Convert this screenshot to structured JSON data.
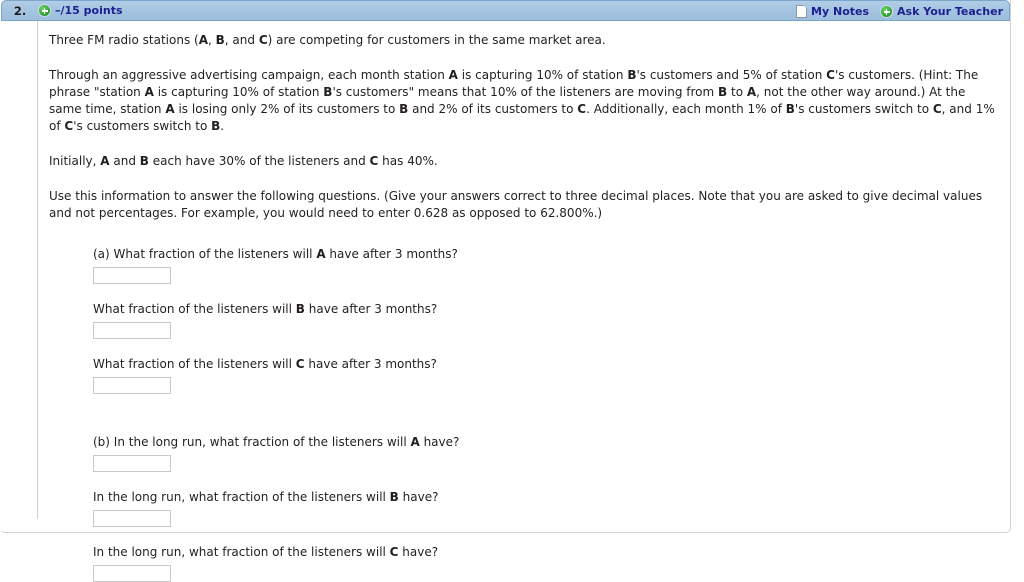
{
  "header": {
    "question_number": "2.",
    "points_label": "–/15 points",
    "plus_icon": "plus-circle-icon",
    "my_notes": {
      "label": "My Notes",
      "icon": "page-icon"
    },
    "ask_teacher": {
      "label": "Ask Your Teacher",
      "icon": "plus-circle-icon"
    }
  },
  "body": {
    "paragraph1": {
      "part1": "Three FM radio stations (",
      "a": "A",
      "part2": ", ",
      "b": "B",
      "part3": ", and ",
      "c": "C",
      "part4": ") are competing for customers in the same market area."
    },
    "paragraph2": {
      "s1": "Through an aggressive advertising campaign, each month station ",
      "a1": "A",
      "s2": " is capturing 10% of station ",
      "b1": "B",
      "s3": "'s customers and 5% of station ",
      "c1": "C",
      "s4": "'s customers. (Hint: The phrase \"station ",
      "a2": "A",
      "s5": " is capturing 10% of station ",
      "b2": "B",
      "s6": "'s customers\" means that 10% of the listeners are moving from ",
      "b3": "B",
      "s7": " to ",
      "a3": "A",
      "s8": ", not the other way around.) At the same time, station ",
      "a4": "A",
      "s9": " is losing only 2% of its customers to ",
      "b4": "B",
      "s10": " and 2% of its customers to ",
      "c2": "C",
      "s11": ". Additionally, each month 1% of ",
      "b5": "B",
      "s12": "'s customers switch to ",
      "c3": "C",
      "s13": ", and 1% of ",
      "c4": "C",
      "s14": "'s customers switch to ",
      "b6": "B",
      "s15": "."
    },
    "paragraph3": {
      "s1": "Initially, ",
      "a": "A",
      "s2": " and ",
      "b": "B",
      "s3": " each have 30% of the listeners and ",
      "c": "C",
      "s4": " has 40%."
    },
    "paragraph4": {
      "text": "Use this information to answer the following questions. (Give your answers correct to three decimal places. Note that you are asked to give decimal values and not percentages. For example, you would need to enter 0.628 as opposed to 62.800%.)"
    }
  },
  "questions": [
    {
      "prefix": "(a) What fraction of the listeners will ",
      "station": "A",
      "suffix": " have after 3 months?",
      "value": "",
      "name": "answer-a-station-a"
    },
    {
      "prefix": "What fraction of the listeners will ",
      "station": "B",
      "suffix": " have after 3 months?",
      "value": "",
      "name": "answer-a-station-b"
    },
    {
      "prefix": "What fraction of the listeners will ",
      "station": "C",
      "suffix": " have after 3 months?",
      "value": "",
      "name": "answer-a-station-c"
    },
    {
      "prefix": "(b) In the long run, what fraction of the listeners will ",
      "station": "A",
      "suffix": " have?",
      "value": "",
      "name": "answer-b-station-a"
    },
    {
      "prefix": "In the long run, what fraction of the listeners will ",
      "station": "B",
      "suffix": " have?",
      "value": "",
      "name": "answer-b-station-b"
    },
    {
      "prefix": "In the long run, what fraction of the listeners will ",
      "station": "C",
      "suffix": " have?",
      "value": "",
      "name": "answer-b-station-c"
    }
  ],
  "colors": {
    "header_bg": "#a9c7e3",
    "header_border": "#7ba5ca",
    "link_text": "#1b1f8f",
    "body_text": "#231f20",
    "input_border": "#c8c8c8",
    "gutter": "#cfcfcf"
  }
}
